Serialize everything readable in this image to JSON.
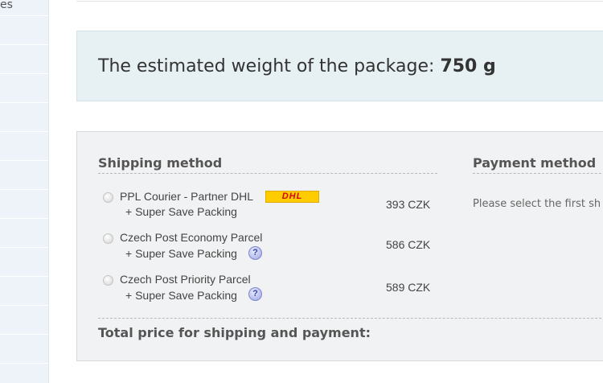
{
  "sidebar": {
    "items": [
      {
        "label": "es"
      },
      {
        "label": ""
      },
      {
        "label": ""
      },
      {
        "label": ""
      },
      {
        "label": ""
      },
      {
        "label": ""
      },
      {
        "label": ""
      },
      {
        "label": ""
      },
      {
        "label": ""
      },
      {
        "label": ""
      },
      {
        "label": ""
      },
      {
        "label": ""
      },
      {
        "label": ""
      },
      {
        "label": ""
      }
    ]
  },
  "weight": {
    "label": "The estimated weight of the package:",
    "value": "750 g"
  },
  "shipping": {
    "heading": "Shipping method",
    "methods": [
      {
        "name": "PPL Courier - Partner DHL",
        "logo_text": "DHL",
        "sub": "+ Super Save Packing",
        "price": "393 CZK",
        "help": false
      },
      {
        "name": "Czech Post Economy Parcel",
        "sub": "+ Super Save Packing",
        "price": "586 CZK",
        "help": true,
        "help_icon": "question-mark"
      },
      {
        "name": "Czech Post Priority Parcel",
        "sub": "+ Super Save Packing",
        "price": "589 CZK",
        "help": true,
        "help_icon": "question-mark"
      }
    ],
    "total_label": "Total price for shipping and payment:"
  },
  "payment": {
    "heading": "Payment method",
    "note": "Please select the first sh"
  },
  "colors": {
    "weight_bg": "#e7f1f3",
    "panel_bg": "#f1f2f3",
    "sidebar_bg": "#eef2f9",
    "dhl_yellow": "#ffcc00",
    "dhl_red": "#d40511"
  }
}
